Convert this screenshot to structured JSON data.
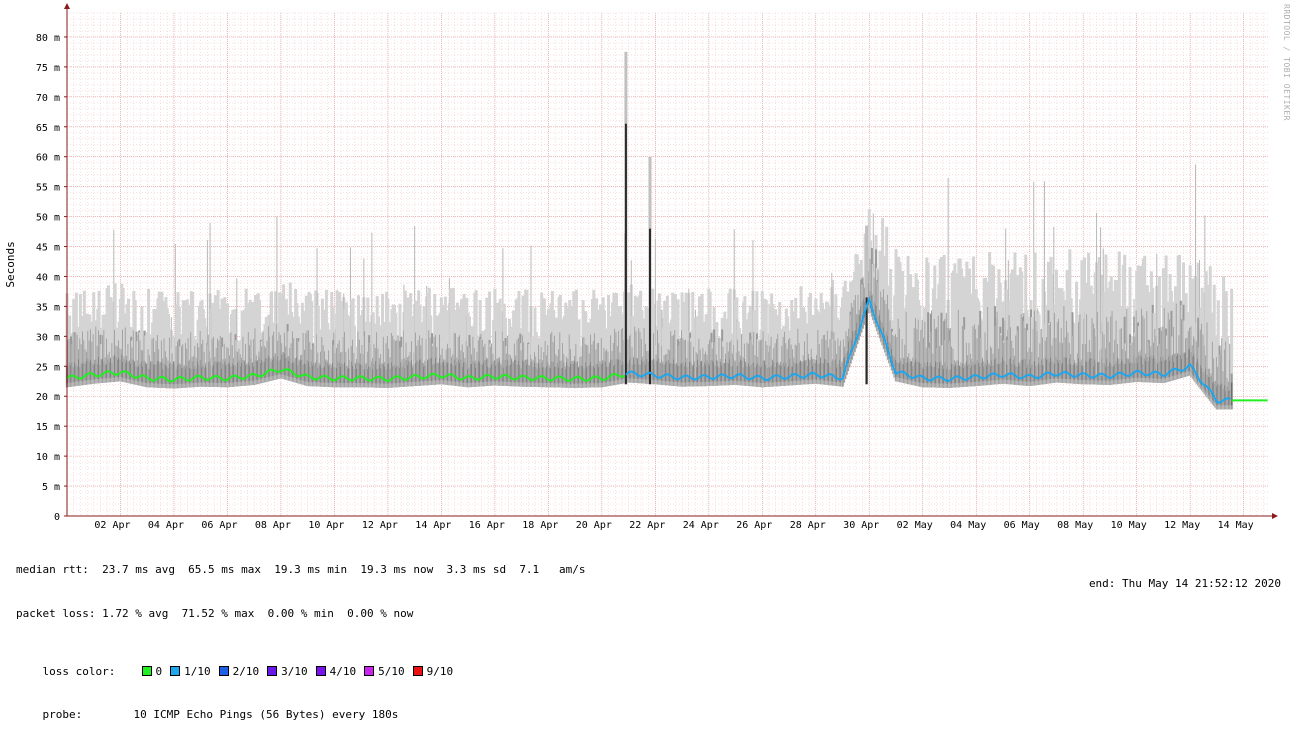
{
  "chart_data": {
    "type": "line",
    "ylabel": "Seconds",
    "ylim": [
      0,
      84
    ],
    "yticks": [
      "0",
      "5 m",
      "10 m",
      "15 m",
      "20 m",
      "25 m",
      "30 m",
      "35 m",
      "40 m",
      "45 m",
      "50 m",
      "55 m",
      "60 m",
      "65 m",
      "70 m",
      "75 m",
      "80 m"
    ],
    "xticks": [
      "02 Apr",
      "04 Apr",
      "06 Apr",
      "08 Apr",
      "10 Apr",
      "12 Apr",
      "14 Apr",
      "16 Apr",
      "18 Apr",
      "20 Apr",
      "22 Apr",
      "24 Apr",
      "26 Apr",
      "28 Apr",
      "30 Apr",
      "02 May",
      "04 May",
      "06 May",
      "08 May",
      "10 May",
      "12 May",
      "14 May"
    ],
    "xrange": [
      "Mar 31 2020",
      "May 14 2020 21:52"
    ],
    "grid": true,
    "series": [
      {
        "name": "median rtt",
        "x": [
          "Mar 31",
          "Apr 1",
          "Apr 2",
          "Apr 3",
          "Apr 4",
          "Apr 5",
          "Apr 6",
          "Apr 7",
          "Apr 8",
          "Apr 9",
          "Apr 10",
          "Apr 11",
          "Apr 12",
          "Apr 13",
          "Apr 14",
          "Apr 15",
          "Apr 16",
          "Apr 17",
          "Apr 18",
          "Apr 19",
          "Apr 20",
          "Apr 21",
          "Apr 22",
          "Apr 23",
          "Apr 24",
          "Apr 25",
          "Apr 26",
          "Apr 27",
          "Apr 28",
          "Apr 29",
          "Apr 30",
          "May 1",
          "May 2",
          "May 3",
          "May 4",
          "May 5",
          "May 6",
          "May 7",
          "May 8",
          "May 9",
          "May 10",
          "May 11",
          "May 12",
          "May 13",
          "May 14"
        ],
        "values": [
          23.0,
          23.6,
          24.0,
          23.0,
          22.8,
          23.1,
          23.0,
          23.4,
          24.5,
          23.2,
          23.0,
          23.0,
          22.9,
          23.2,
          23.5,
          23.0,
          23.3,
          23.1,
          23.0,
          22.9,
          23.0,
          23.8,
          23.5,
          23.1,
          23.2,
          23.4,
          23.0,
          23.3,
          23.6,
          23.1,
          36.0,
          24.0,
          23.0,
          22.9,
          23.2,
          23.6,
          23.2,
          23.8,
          23.5,
          23.4,
          23.9,
          23.7,
          25.0,
          19.3,
          19.3
        ]
      }
    ],
    "spikes": [
      {
        "x": "Apr 21",
        "value": 65.5
      },
      {
        "x": "Apr 22",
        "value": 48.0
      },
      {
        "x": "Apr 30",
        "value": 36.5
      }
    ]
  },
  "stats": {
    "line1": "median rtt:  23.7 ms avg  65.5 ms max  19.3 ms min  19.3 ms now  3.3 ms sd  7.1   am/s",
    "line2": "packet loss: 1.72 % avg  71.52 % max  0.00 % min  0.00 % now",
    "loss_label": "loss color:",
    "probe_label": "probe:",
    "probe_text": "10 ICMP Echo Pings (56 Bytes) every 180s",
    "end_text": "end: Thu May 14 21:52:12 2020"
  },
  "loss_colors": [
    {
      "label": "0",
      "color": "#22ee22"
    },
    {
      "label": "1/10",
      "color": "#1ea6ee"
    },
    {
      "label": "2/10",
      "color": "#1f5fe8"
    },
    {
      "label": "3/10",
      "color": "#6a18e8"
    },
    {
      "label": "4/10",
      "color": "#7a10ee"
    },
    {
      "label": "5/10",
      "color": "#cc22ee"
    },
    {
      "label": "9/10",
      "color": "#ee1111"
    }
  ],
  "watermark": "RRDTOOL / TOBI OETIKER",
  "colors": {
    "grid_minor": "#f0c0c0",
    "grid_major": "#e09a9a",
    "axis": "#8b1a1a",
    "smoke": "#6e6e6e"
  }
}
